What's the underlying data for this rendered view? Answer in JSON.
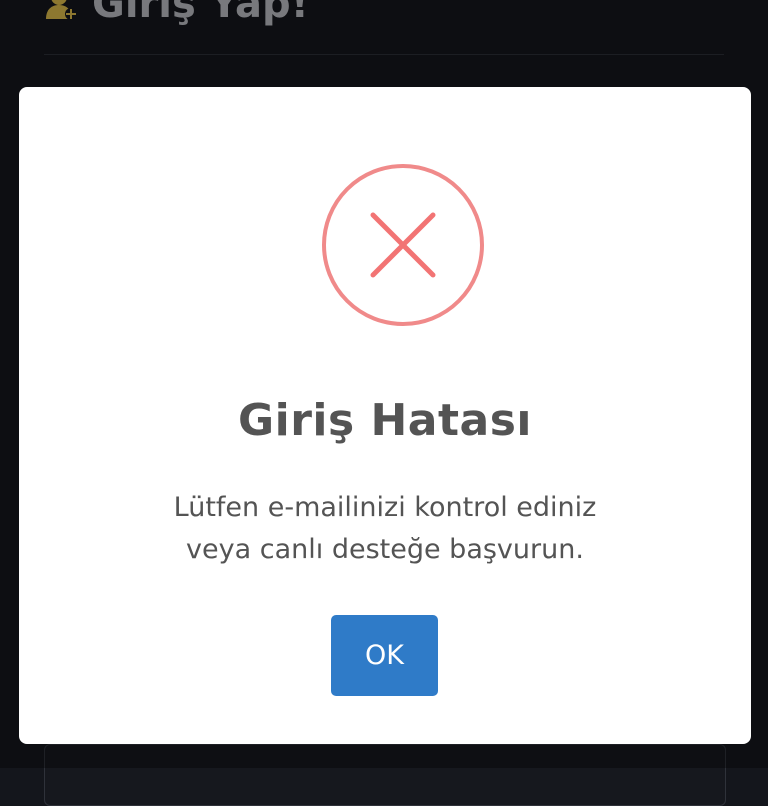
{
  "background": {
    "page_title": "Giriş Yap!",
    "icon": "user-plus-icon"
  },
  "alert": {
    "icon": "error-x-icon",
    "title": "Giriş Hatası",
    "message_line1": "Lütfen e-mailinizi kontrol ediniz",
    "message_line2": "veya canlı desteğe başvurun.",
    "ok_label": "OK"
  },
  "colors": {
    "error_ring": "#f08a8a",
    "error_x": "#f27474",
    "button": "#2f7bc8",
    "text": "#545454",
    "page_bg": "#14161c",
    "icon_gold": "#d9b94a"
  }
}
